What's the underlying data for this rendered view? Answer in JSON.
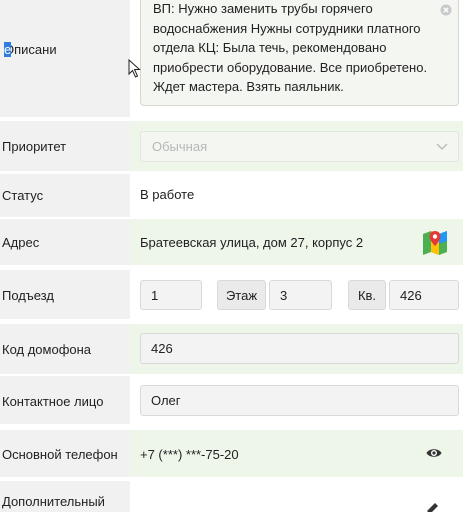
{
  "description": {
    "label": "Описание",
    "label_main": "Описани",
    "label_cursor": "е",
    "text": "ВП: Нужно заменить трубы горячего водоснабжения Нужны сотрудники платного отдела КЦ: Была течь, рекомендовано приобрести оборудование. Все приобретено. Ждет мастера. Взять паяльник."
  },
  "priority": {
    "label": "Приоритет",
    "value": "Обычная"
  },
  "status": {
    "label": "Статус",
    "value": "В работе"
  },
  "address": {
    "label": "Адрес",
    "value": "Братеевская улица, дом 27, корпус 2",
    "icon": "map-icon"
  },
  "entrance": {
    "label": "Подъезд",
    "value": "1",
    "floor_label": "Этаж",
    "floor_value": "3",
    "apt_label": "Кв.",
    "apt_value": "426"
  },
  "intercom": {
    "label": "Код домофона",
    "value": "426"
  },
  "contact": {
    "label": "Контактное лицо",
    "value": "Олег"
  },
  "phone": {
    "label": "Основной телефон",
    "value": "+7 (***) ***-75-20",
    "icon": "eye-icon"
  },
  "extra_phone": {
    "label": "Дополнительный",
    "icon": "pencil-icon"
  },
  "colors": {
    "green_bg": "#eef5e9",
    "label_bg": "#f1f1f1"
  }
}
